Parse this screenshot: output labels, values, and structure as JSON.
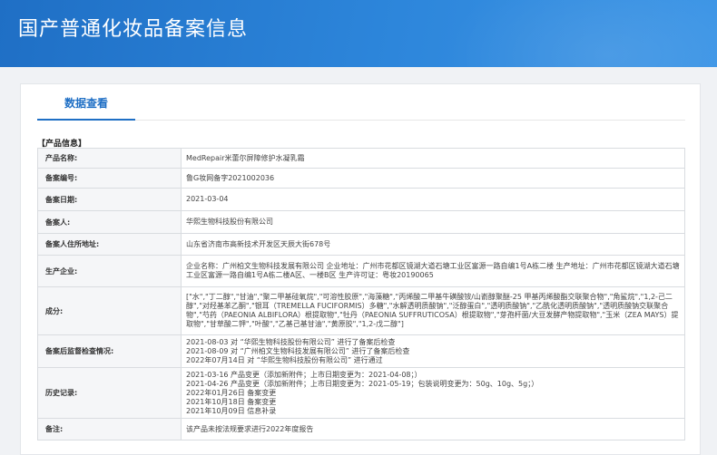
{
  "header": {
    "title": "国产普通化妆品备案信息"
  },
  "tabs": [
    {
      "label": "数据查看"
    }
  ],
  "section_title": "【产品信息】",
  "rows": {
    "product_name": {
      "label": "产品名称:",
      "value": "MedRepair米蕾尔屏障修护水凝乳霜"
    },
    "record_no": {
      "label": "备案编号:",
      "value": "鲁G妆网备字2021002036"
    },
    "record_date": {
      "label": "备案日期:",
      "value": "2021-03-04"
    },
    "registrant": {
      "label": "备案人:",
      "value": "华熙生物科技股份有限公司"
    },
    "registrant_address": {
      "label": "备案人住所地址:",
      "value": "山东省济南市高新技术开发区天辰大街678号"
    },
    "manufacturer": {
      "label": "生产企业:",
      "value": "企业名称：广州柏文生物科技发展有限公司 企业地址：广州市花都区镜湖大道石塘工业区富源一路自编1号A栋二楼 生产地址：广州市花都区镜湖大道石塘工业区富源一路自编1号A栋二楼A区、一楼B区 生产许可证：粤妆20190065"
    },
    "ingredients": {
      "label": "成分:",
      "value": "[\"水\",\"丁二醇\",\"甘油\",\"聚二甲基硅氧烷\",\"可溶性胶原\",\"海藻糖\",\"丙烯酸二甲基牛磺酸铵/山嵛醇聚醚-25 甲基丙烯酸酯交联聚合物\",\"角鲨烷\",\"1,2-己二醇\",\"对羟基苯乙酮\",\"银耳（TREMELLA FUCIFORMIS）多糖\",\"水解透明质酸钠\",\"泛醇蛋白\",\"透明质酸钠\",\"乙酰化透明质酸钠\",\"透明质酸钠交联聚合物\",\"芍药（PAEONIA ALBIFLORA）根提取物\",\"牡丹（PAEONIA SUFFRUTICOSA）根提取物\",\"芽孢杆菌/大豆发酵产物提取物\",\"玉米（ZEA MAYS）提取物\",\"甘草酸二钾\",\"叶酸\",\"乙基己基甘油\",\"黄原胶\",\"1,2-戊二醇\"]"
    },
    "post_check": {
      "label": "备案后监督检查情况:",
      "lines": [
        "2021-08-03 对 “华熙生物科技股份有限公司” 进行了备案后检查",
        "2021-08-09 对 “广州柏文生物科技发展有限公司” 进行了备案后检查",
        "2022年07月14日 对 “华熙生物科技股份有限公司” 进行通过"
      ]
    },
    "history": {
      "label": "历史记录:",
      "lines": [
        "2021-03-16 产品变更（添加新附件；上市日期变更为：2021-04-08；）",
        "2021-04-26 产品变更（添加新附件；上市日期变更为：2021-05-19；包装说明变更为：50g、10g、5g；）",
        "2022年01月26日 备案变更",
        "2021年10月18日 备案变更",
        "2021年10月09日 信息补录"
      ]
    },
    "remarks": {
      "label": "备注:",
      "value": "该产品未按法规要求进行2022年度报告"
    }
  }
}
